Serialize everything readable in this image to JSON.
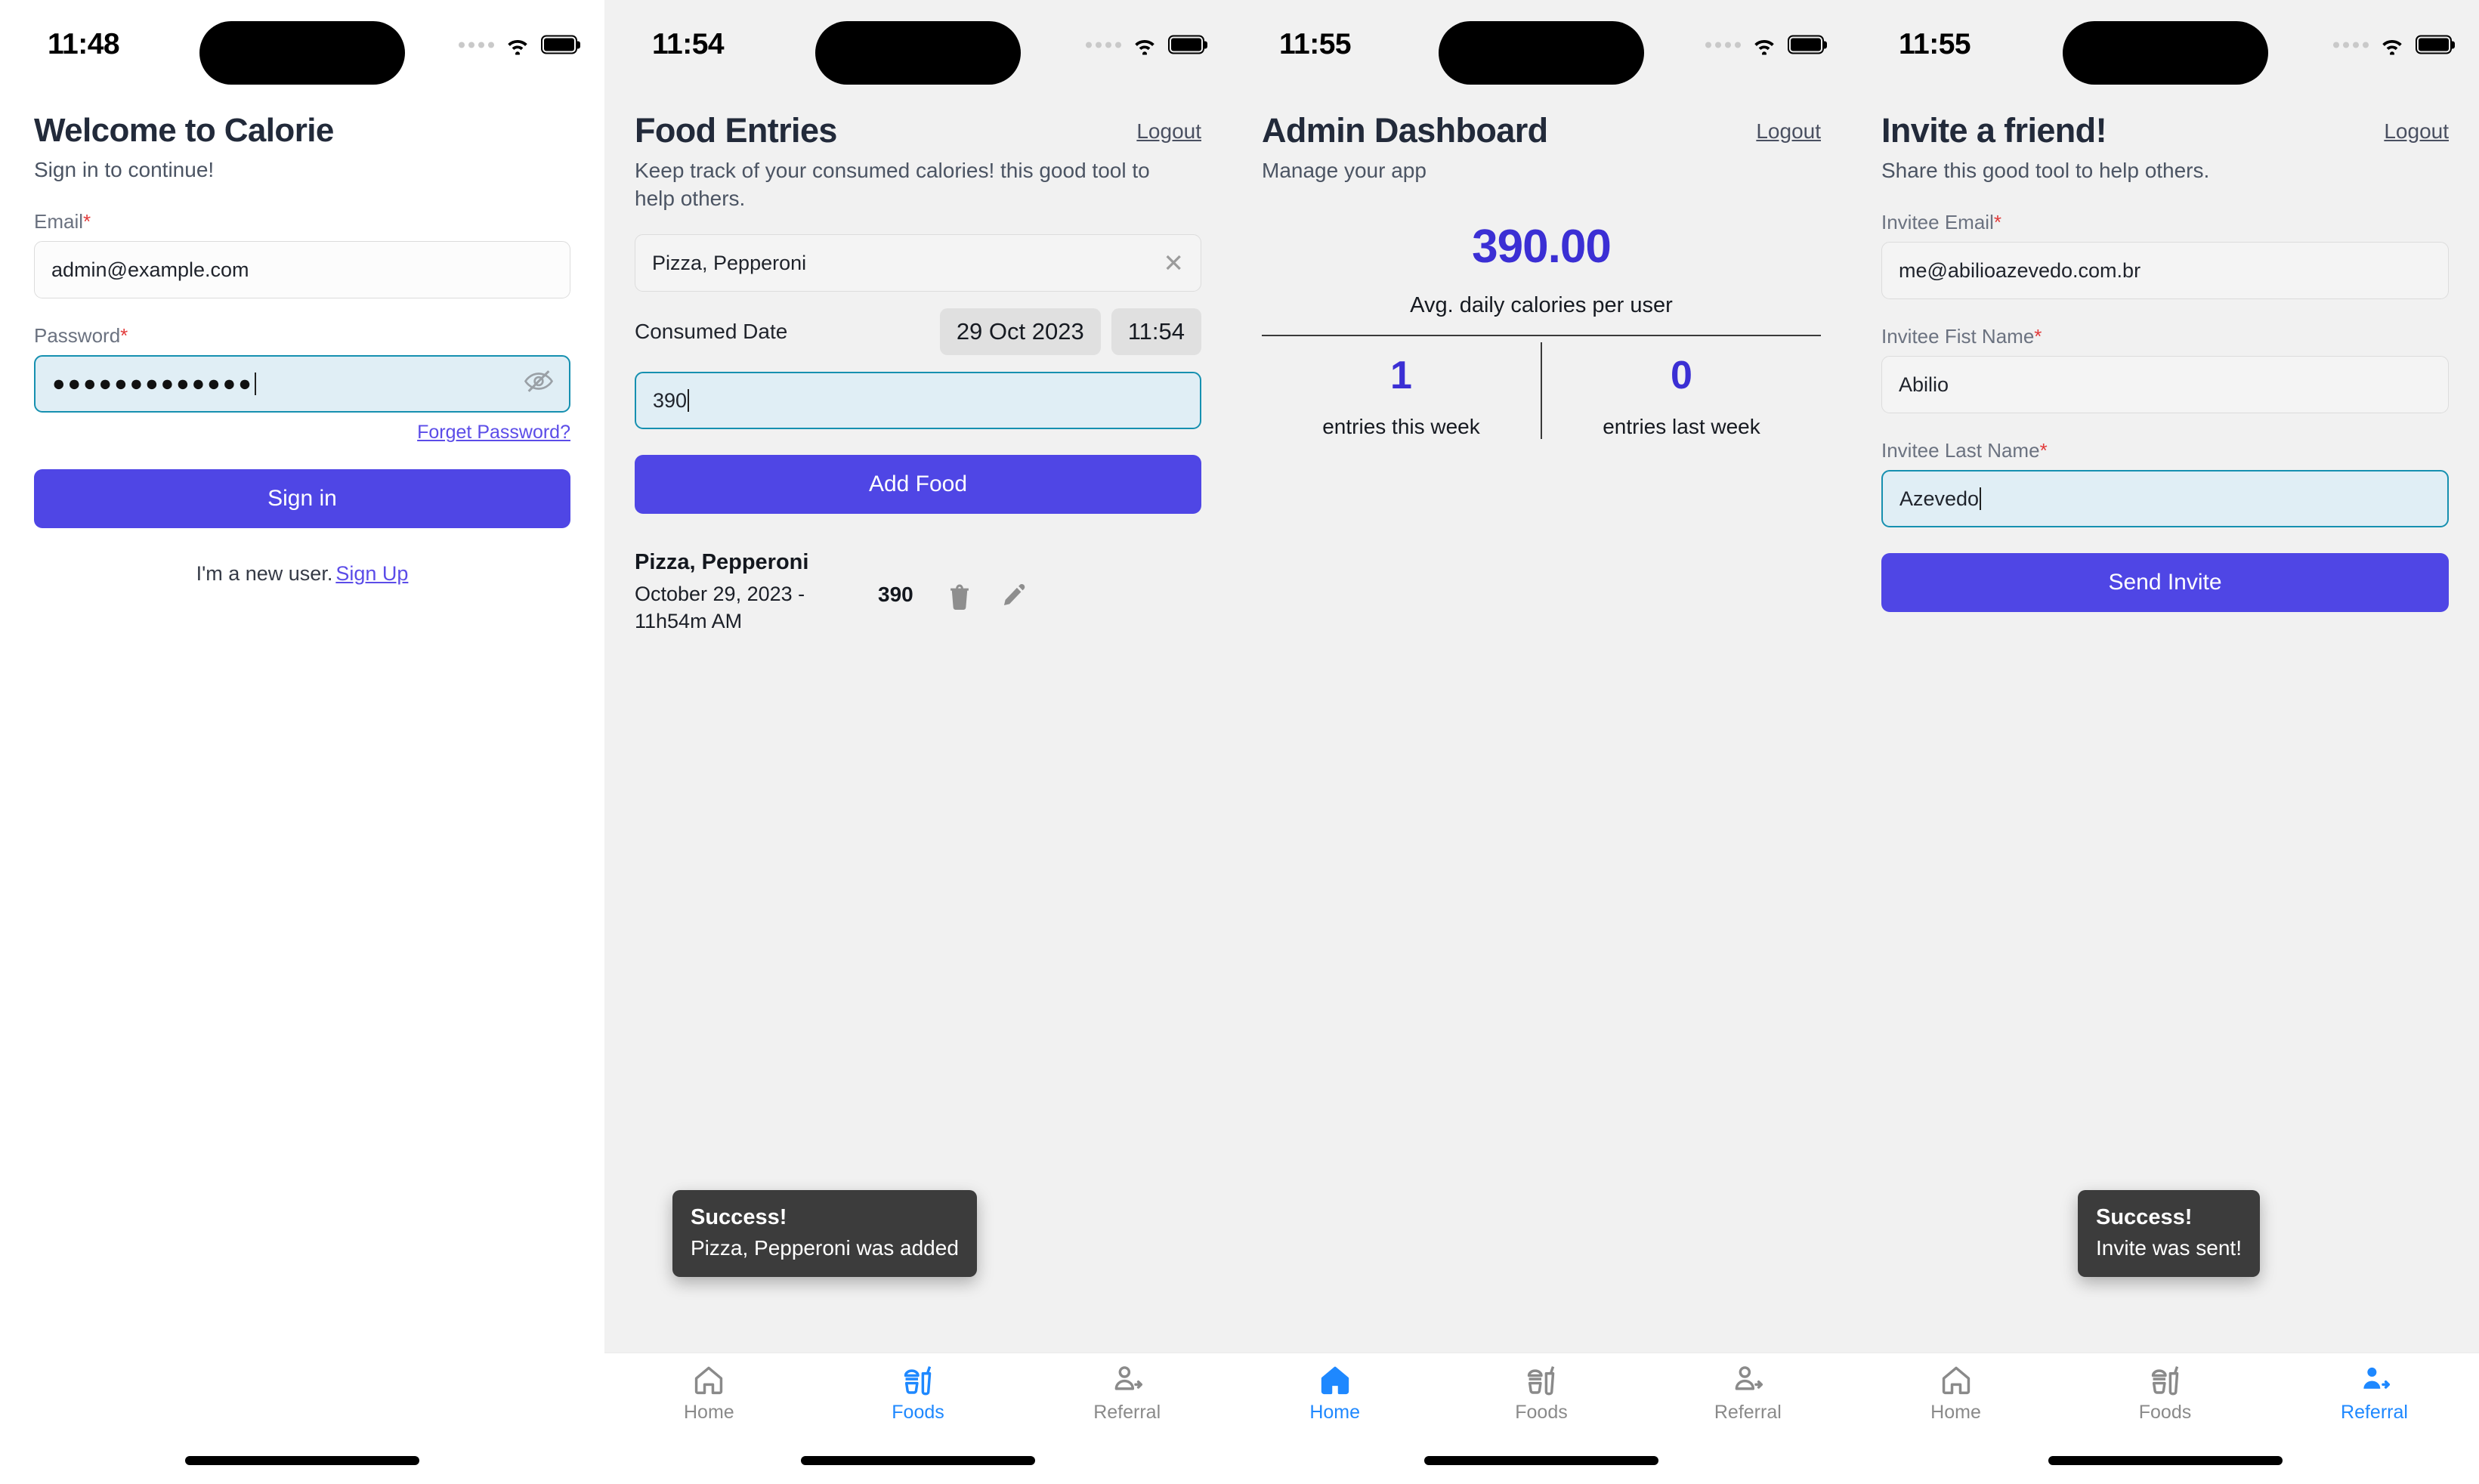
{
  "panels": [
    {
      "status": {
        "time": "11:48"
      },
      "title": "Welcome to Calorie",
      "subtitle": "Sign in to continue!",
      "email_label": "Email",
      "email_value": "admin@example.com",
      "password_label": "Password",
      "password_value": "●●●●●●●●●●●●●",
      "forget_password": "Forget Password?",
      "signin_button": "Sign in",
      "newuser_text": "I'm a new user.",
      "signup_link": "Sign Up",
      "required_mark": "*"
    },
    {
      "status": {
        "time": "11:54"
      },
      "title": "Food Entries",
      "logout": "Logout",
      "subtitle": "Keep track of your consumed calories! this good tool to help others.",
      "food_value": "Pizza, Pepperoni",
      "consumed_date_label": "Consumed Date",
      "date_chip": "29 Oct 2023",
      "time_chip": "11:54",
      "calories_value": "390",
      "add_button": "Add Food",
      "entry": {
        "name": "Pizza, Pepperoni",
        "datetime": "October 29, 2023 - 11h54m AM",
        "calories": "390"
      },
      "toast": {
        "title": "Success!",
        "message": "Pizza, Pepperoni was added"
      },
      "tabs": [
        {
          "label": "Home",
          "icon": "home-icon",
          "active": false
        },
        {
          "label": "Foods",
          "icon": "foods-icon",
          "active": true
        },
        {
          "label": "Referral",
          "icon": "referral-icon",
          "active": false
        }
      ]
    },
    {
      "status": {
        "time": "11:55"
      },
      "title": "Admin Dashboard",
      "logout": "Logout",
      "subtitle": "Manage your app",
      "avg_value": "390.00",
      "avg_caption": "Avg. daily calories per user",
      "stats": [
        {
          "value": "1",
          "label": "entries this week"
        },
        {
          "value": "0",
          "label": "entries last week"
        }
      ],
      "tabs": [
        {
          "label": "Home",
          "icon": "home-icon",
          "active": true
        },
        {
          "label": "Foods",
          "icon": "foods-icon",
          "active": false
        },
        {
          "label": "Referral",
          "icon": "referral-icon",
          "active": false
        }
      ]
    },
    {
      "status": {
        "time": "11:55"
      },
      "title": "Invite a friend!",
      "logout": "Logout",
      "subtitle": "Share this good tool to help others.",
      "email_label": "Invitee Email",
      "email_value": "me@abilioazevedo.com.br",
      "first_label": "Invitee Fist Name",
      "first_value": "Abilio",
      "last_label": "Invitee Last Name",
      "last_value": "Azevedo",
      "send_button": "Send Invite",
      "required_mark": "*",
      "toast": {
        "title": "Success!",
        "message": "Invite was sent!"
      },
      "tabs": [
        {
          "label": "Home",
          "icon": "home-icon",
          "active": false
        },
        {
          "label": "Foods",
          "icon": "foods-icon",
          "active": false
        },
        {
          "label": "Referral",
          "icon": "referral-icon",
          "active": true
        }
      ]
    }
  ],
  "colors": {
    "primary": "#4f46e5",
    "accent_blue": "#1e88ff",
    "stat_purple": "#3b2fd4",
    "focus_border": "#1690b0",
    "focus_fill": "#e0eef5",
    "required_red": "#e23b3b",
    "panel_bg": "#f1f1f1",
    "toast_bg": "#3c3c3c"
  }
}
